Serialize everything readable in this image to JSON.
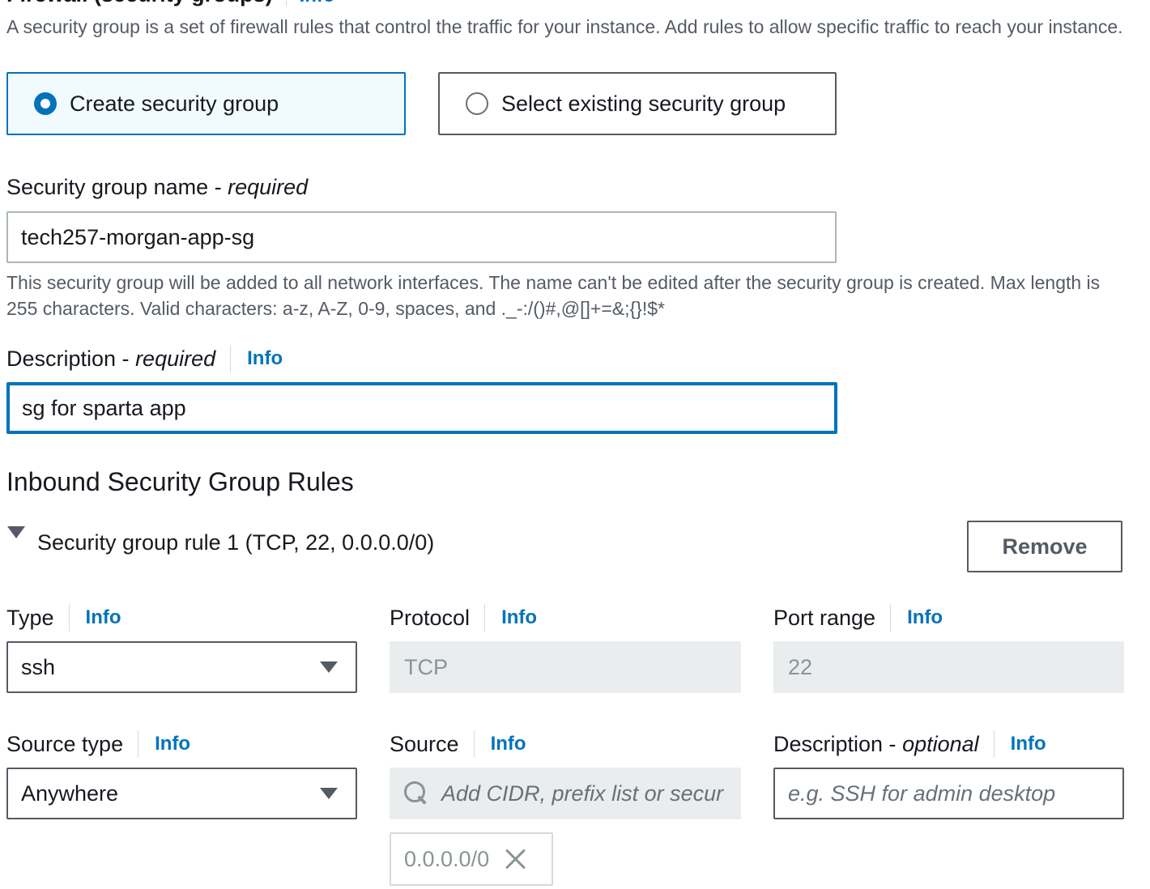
{
  "firewall": {
    "title": "Firewall (security groups)",
    "info": "Info",
    "description": "A security group is a set of firewall rules that control the traffic for your instance. Add rules to allow specific traffic to reach your instance.",
    "options": [
      {
        "label": "Create security group",
        "selected": true
      },
      {
        "label": "Select existing security group",
        "selected": false
      }
    ]
  },
  "sg_name": {
    "label": "Security group name - ",
    "label_emphasis": "required",
    "value": "tech257-morgan-app-sg",
    "help": "This security group will be added to all network interfaces. The name can't be edited after the security group is created. Max length is 255 characters. Valid characters: a-z, A-Z, 0-9, spaces, and ._-:/()#,@[]+=&;{}!$*"
  },
  "sg_description": {
    "label": "Description - ",
    "label_emphasis": "required",
    "info": "Info",
    "value": "sg for sparta app"
  },
  "inbound": {
    "heading": "Inbound Security Group Rules",
    "rule_title": "Security group rule 1 (TCP, 22, 0.0.0.0/0)",
    "remove_label": "Remove",
    "type": {
      "label": "Type",
      "info": "Info",
      "value": "ssh"
    },
    "protocol": {
      "label": "Protocol",
      "info": "Info",
      "value": "TCP"
    },
    "port_range": {
      "label": "Port range",
      "info": "Info",
      "value": "22"
    },
    "source_type": {
      "label": "Source type",
      "info": "Info",
      "value": "Anywhere"
    },
    "source": {
      "label": "Source",
      "info": "Info",
      "placeholder": "Add CIDR, prefix list or secur",
      "token": "0.0.0.0/0"
    },
    "rule_description": {
      "label": "Description - ",
      "label_emphasis": "optional",
      "info": "Info",
      "placeholder": "e.g. SSH for admin desktop"
    }
  },
  "colors": {
    "accent": "#0073bb",
    "text": "#16191f",
    "muted": "#545b64"
  }
}
